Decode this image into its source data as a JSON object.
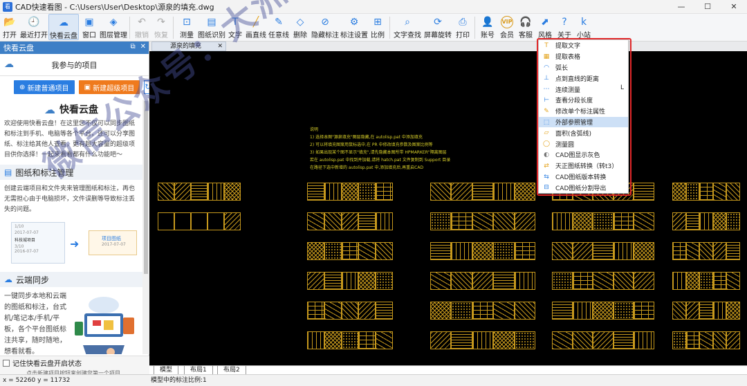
{
  "window": {
    "app_icon_text": "看",
    "title": "CAD快速看图 - C:\\Users\\User\\Desktop\\源泉的填充.dwg",
    "controls": [
      "—",
      "☐",
      "✕"
    ]
  },
  "toolbar": {
    "buttons": [
      {
        "label": "打开",
        "icon": "folder-icon",
        "glyph": "📂",
        "color": "#2a7de1"
      },
      {
        "label": "最近打开",
        "icon": "clock-icon",
        "glyph": "🕘",
        "color": "#2a7de1"
      },
      {
        "label": "快看云盘",
        "icon": "cloud-icon",
        "glyph": "☁",
        "color": "#2a7de1",
        "active": true
      },
      {
        "label": "窗口",
        "icon": "window-icon",
        "glyph": "▣",
        "color": "#2a7de1"
      },
      {
        "label": "图层管理",
        "icon": "layers-icon",
        "glyph": "◈",
        "color": "#2a7de1"
      },
      {
        "label": "撤销",
        "icon": "undo-icon",
        "glyph": "↶",
        "color": "#aaa",
        "disabled": true
      },
      {
        "label": "恢复",
        "icon": "redo-icon",
        "glyph": "↷",
        "color": "#aaa",
        "disabled": true
      },
      {
        "label": "测量",
        "icon": "measure-icon",
        "glyph": "⊡",
        "color": "#2a7de1"
      },
      {
        "label": "图纸识别",
        "icon": "recognize-icon",
        "glyph": "▤",
        "color": "#2a7de1"
      },
      {
        "label": "文字",
        "icon": "text-icon",
        "glyph": "T",
        "color": "#2a7de1"
      },
      {
        "label": "画直线",
        "icon": "line-icon",
        "glyph": "╱",
        "color": "#e3a21a"
      },
      {
        "label": "任意线",
        "icon": "freehand-icon",
        "glyph": "✎",
        "color": "#2a7de1"
      },
      {
        "label": "删除",
        "icon": "eraser-icon",
        "glyph": "◇",
        "color": "#2a7de1"
      },
      {
        "label": "隐藏标注",
        "icon": "hide-icon",
        "glyph": "⊘",
        "color": "#2a7de1"
      },
      {
        "label": "标注设置",
        "icon": "settings-icon",
        "glyph": "⚙",
        "color": "#2a7de1"
      },
      {
        "label": "比例",
        "icon": "scale-icon",
        "glyph": "⊞",
        "color": "#2a7de1"
      },
      {
        "label": "文字查找",
        "icon": "text-search-icon",
        "glyph": "⌕",
        "color": "#2a7de1"
      },
      {
        "label": "屏幕旋转",
        "icon": "rotate-icon",
        "glyph": "⟳",
        "color": "#2a7de1"
      },
      {
        "label": "打印",
        "icon": "print-icon",
        "glyph": "⎙",
        "color": "#2a7de1"
      },
      {
        "label": "账号",
        "icon": "user-icon",
        "glyph": "👤",
        "color": "#2a7de1"
      },
      {
        "label": "会员",
        "icon": "vip-icon",
        "glyph": "VIP",
        "color": "#d99a1a"
      },
      {
        "label": "客服",
        "icon": "headset-icon",
        "glyph": "🎧",
        "color": "#2a7de1"
      },
      {
        "label": "风格",
        "icon": "style-icon",
        "glyph": "⬈",
        "color": "#2a7de1"
      },
      {
        "label": "关于",
        "icon": "about-icon",
        "glyph": "?",
        "color": "#2a7de1"
      },
      {
        "label": "小站",
        "icon": "site-icon",
        "glyph": "k",
        "color": "#2a7de1"
      }
    ]
  },
  "sidebar": {
    "header_title": "快看云盘",
    "header_btns": [
      "⧉",
      "✕"
    ],
    "project_title": "我参与的项目",
    "btn_new_normal": "新建普通项目",
    "btn_new_super": "新建超级项目",
    "refresh_glyph": "↻",
    "intro_title": "快看云盘",
    "intro_text": "欢迎使用快看云盘！在这里您不仅可以同步图纸和标注到手机、电脑等各个平台，还可以分享图纸、标注给其他人查看，更有超大容量的超级项目供你选择！一起来看看都有什么功能吧～",
    "sec1_title": "图纸和标注管理",
    "sec1_text": "创建云端项目和文件夹来管理图纸和标注，再也无需担心由于电脑损坏，文件误删等导致标注丢失的问题。",
    "illus_labels": [
      "科技城项目",
      "2017-07-07",
      "2016-07-07",
      "1/10",
      "3/10",
      "项目图纸",
      "2017-07-07"
    ],
    "sec2_title": "云端同步",
    "sec2_text": "一键同步本地和云端的图纸和标注，台式机/笔记本/手机/平板，各个平台图纸标注共享，随时随地，想看就看。",
    "remember_label": "记住快看云盘开启状态",
    "hint": "点击新建项目按钮来创建您第一个项目"
  },
  "doc_tab": {
    "label": "源泉的填充",
    "close": "✕"
  },
  "canvas": {
    "notes": [
      "说明",
      "1) 选择本图\"源泉填充\"图层隐藏,在 autolisp.pat 中添加填充",
      "2) 可以将填充图案用鼠标选中,在 PR 中修改填充参数及图案比例等",
      "3) 如果出现某个图不显示\"填充\",请先隐藏本图所带 HPMARKER\"隔离图层",
      "   若在 autolisp.pat 中找到并加载,请将 hatch.pat 文件复制到 Support 目录",
      "   在路径下选中新增的 autolisp.pat 中,添加填充后,再重启CAD"
    ],
    "watermark": "微信公众号：大洲路资源网"
  },
  "context_menu": {
    "items": [
      {
        "label": "提取文字",
        "icon": "extract-text-icon",
        "glyph": "T",
        "color": "#e3a21a"
      },
      {
        "label": "提取表格",
        "icon": "extract-table-icon",
        "glyph": "▦",
        "color": "#e3a21a"
      },
      {
        "label": "弧长",
        "icon": "arc-icon",
        "glyph": "◠",
        "color": "#2a7de1"
      },
      {
        "label": "点到直线的距离",
        "icon": "point-line-icon",
        "glyph": "⊥",
        "color": "#2a7de1"
      },
      {
        "label": "连续测量",
        "icon": "continuous-measure-icon",
        "glyph": "⋯",
        "color": "#2a7de1",
        "shortcut": "L"
      },
      {
        "label": "查看分段长度",
        "icon": "segment-icon",
        "glyph": "⊢",
        "color": "#2a7de1"
      },
      {
        "label": "修改单个标注属性",
        "icon": "edit-annotation-icon",
        "glyph": "✎",
        "color": "#e3a21a"
      },
      {
        "label": "外部参照管理",
        "icon": "xref-icon",
        "glyph": "⬚",
        "color": "#2a7de1",
        "highlight": true
      },
      {
        "label": "面积(含弧线)",
        "icon": "area-icon",
        "glyph": "▱",
        "color": "#e3a21a"
      },
      {
        "label": "测量圆",
        "icon": "circle-measure-icon",
        "glyph": "◯",
        "color": "#e3a21a"
      },
      {
        "label": "CAD图显示灰色",
        "icon": "gray-display-icon",
        "glyph": "◐",
        "color": "#777"
      },
      {
        "label": "天正图纸转换（转t3）",
        "icon": "tangent-convert-icon",
        "glyph": "⇄",
        "color": "#e3a21a"
      },
      {
        "label": "CAD图纸版本转换",
        "icon": "version-convert-icon",
        "glyph": "⇆",
        "color": "#2a7de1"
      },
      {
        "label": "CAD图纸分割导出",
        "icon": "split-export-icon",
        "glyph": "⊟",
        "color": "#2a7de1"
      }
    ]
  },
  "layout_tabs": [
    "模型",
    "布局1",
    "布局2"
  ],
  "status": {
    "coords": "x = 52260  y = 11732",
    "scale": "模型中的标注比例:1"
  },
  "colors": {
    "accent": "#2a7de1",
    "hatch": "#c7991d",
    "menu_frame": "#e0282a",
    "canvas_bg": "#000000"
  }
}
